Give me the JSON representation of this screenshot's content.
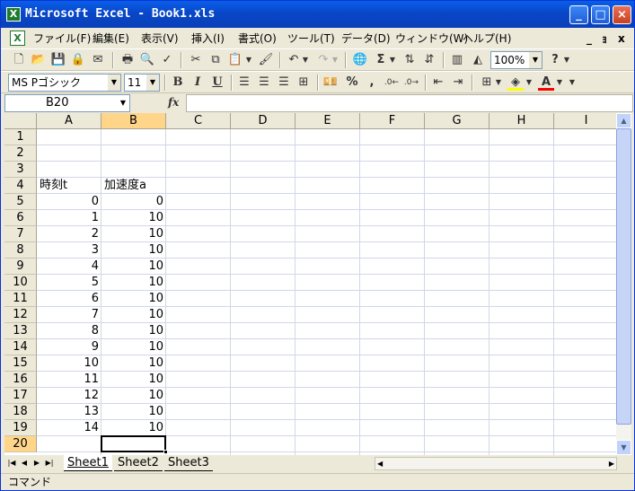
{
  "window": {
    "title": "Microsoft Excel - Book1.xls",
    "app_icon": "excel-icon",
    "controls": {
      "minimize": "minimize-icon",
      "maximize": "maximize-icon",
      "close": "close-icon"
    }
  },
  "menu": {
    "items": [
      "ファイル(F)",
      "編集(E)",
      "表示(V)",
      "挿入(I)",
      "書式(O)",
      "ツール(T)",
      "データ(D)",
      "ウィンドウ(W)",
      "ヘルプ(H)"
    ],
    "doc_controls": [
      "_",
      "ｮ",
      "x"
    ]
  },
  "toolbar": {
    "zoom": "100%",
    "font_name": "MS Pゴシック",
    "font_size": "11",
    "bold": "B",
    "italic": "I",
    "underline": "U",
    "percent": "%",
    "comma": ",",
    "sigma": "Σ",
    "help": "?"
  },
  "formula_bar": {
    "name_box": "B20",
    "fx": "fx",
    "formula": ""
  },
  "grid": {
    "columns": [
      "A",
      "B",
      "C",
      "D",
      "E",
      "F",
      "G",
      "H",
      "I"
    ],
    "rows": [
      "1",
      "2",
      "3",
      "4",
      "5",
      "6",
      "7",
      "8",
      "9",
      "10",
      "11",
      "12",
      "13",
      "14",
      "15",
      "16",
      "17",
      "18",
      "19",
      "20"
    ],
    "selected_column": "B",
    "selected_row": "20",
    "headers": {
      "A4": "時刻t",
      "B4": "加速度a"
    },
    "data": [
      {
        "row": "5",
        "a": "0",
        "b": "0"
      },
      {
        "row": "6",
        "a": "1",
        "b": "10"
      },
      {
        "row": "7",
        "a": "2",
        "b": "10"
      },
      {
        "row": "8",
        "a": "3",
        "b": "10"
      },
      {
        "row": "9",
        "a": "4",
        "b": "10"
      },
      {
        "row": "10",
        "a": "5",
        "b": "10"
      },
      {
        "row": "11",
        "a": "6",
        "b": "10"
      },
      {
        "row": "12",
        "a": "7",
        "b": "10"
      },
      {
        "row": "13",
        "a": "8",
        "b": "10"
      },
      {
        "row": "14",
        "a": "9",
        "b": "10"
      },
      {
        "row": "15",
        "a": "10",
        "b": "10"
      },
      {
        "row": "16",
        "a": "11",
        "b": "10"
      },
      {
        "row": "17",
        "a": "12",
        "b": "10"
      },
      {
        "row": "18",
        "a": "13",
        "b": "10"
      },
      {
        "row": "19",
        "a": "14",
        "b": "10"
      }
    ]
  },
  "sheets": {
    "tabs": [
      "Sheet1",
      "Sheet2",
      "Sheet3"
    ],
    "active": "Sheet1"
  },
  "status_bar": {
    "text": "コマンド"
  }
}
